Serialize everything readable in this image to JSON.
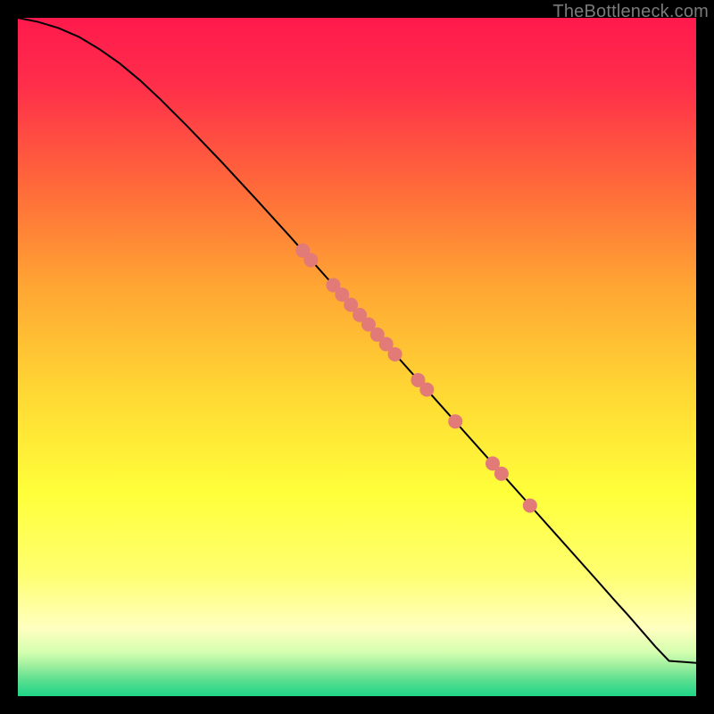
{
  "watermark": "TheBottleneck.com",
  "colors": {
    "marker_fill": "#e27a78",
    "marker_stroke": "#b85452",
    "curve_stroke": "#000000"
  },
  "chart_data": {
    "type": "line",
    "title": "",
    "xlabel": "",
    "ylabel": "",
    "xlim": [
      0,
      100
    ],
    "ylim": [
      0,
      100
    ],
    "background_gradient_stops": [
      {
        "offset": 0.0,
        "color": "#ff1a4d"
      },
      {
        "offset": 0.1,
        "color": "#ff2e4a"
      },
      {
        "offset": 0.25,
        "color": "#ff6a3a"
      },
      {
        "offset": 0.4,
        "color": "#ffa733"
      },
      {
        "offset": 0.55,
        "color": "#ffd733"
      },
      {
        "offset": 0.7,
        "color": "#ffff3a"
      },
      {
        "offset": 0.82,
        "color": "#ffff70"
      },
      {
        "offset": 0.9,
        "color": "#ffffc0"
      },
      {
        "offset": 0.935,
        "color": "#d5ffb0"
      },
      {
        "offset": 0.955,
        "color": "#9fef9f"
      },
      {
        "offset": 0.975,
        "color": "#5ee090"
      },
      {
        "offset": 1.0,
        "color": "#1fd488"
      }
    ],
    "series": [
      {
        "name": "curve",
        "x": [
          0,
          3,
          6,
          9,
          12,
          15,
          18,
          21,
          25,
          30,
          35,
          40,
          45,
          50,
          55,
          60,
          65,
          70,
          75,
          80,
          85,
          88,
          90,
          92,
          94,
          96,
          100
        ],
        "y": [
          100,
          99.4,
          98.5,
          97.2,
          95.4,
          93.3,
          90.8,
          88.0,
          84.0,
          78.8,
          73.4,
          67.9,
          62.3,
          56.7,
          51.1,
          45.5,
          39.9,
          34.3,
          28.7,
          23.1,
          17.5,
          14.1,
          11.9,
          9.6,
          7.3,
          5.2,
          4.9
        ]
      }
    ],
    "markers": [
      {
        "x": 42.0,
        "y": 65.7
      },
      {
        "x": 43.2,
        "y": 64.3
      },
      {
        "x": 46.5,
        "y": 60.6
      },
      {
        "x": 47.8,
        "y": 59.2
      },
      {
        "x": 49.1,
        "y": 57.7
      },
      {
        "x": 50.4,
        "y": 56.2
      },
      {
        "x": 51.7,
        "y": 54.8
      },
      {
        "x": 53.0,
        "y": 53.3
      },
      {
        "x": 54.3,
        "y": 51.9
      },
      {
        "x": 55.6,
        "y": 50.4
      },
      {
        "x": 59.0,
        "y": 46.6
      },
      {
        "x": 60.3,
        "y": 45.2
      },
      {
        "x": 64.5,
        "y": 40.5
      },
      {
        "x": 70.0,
        "y": 34.3
      },
      {
        "x": 71.3,
        "y": 32.8
      },
      {
        "x": 75.5,
        "y": 28.1
      }
    ]
  }
}
